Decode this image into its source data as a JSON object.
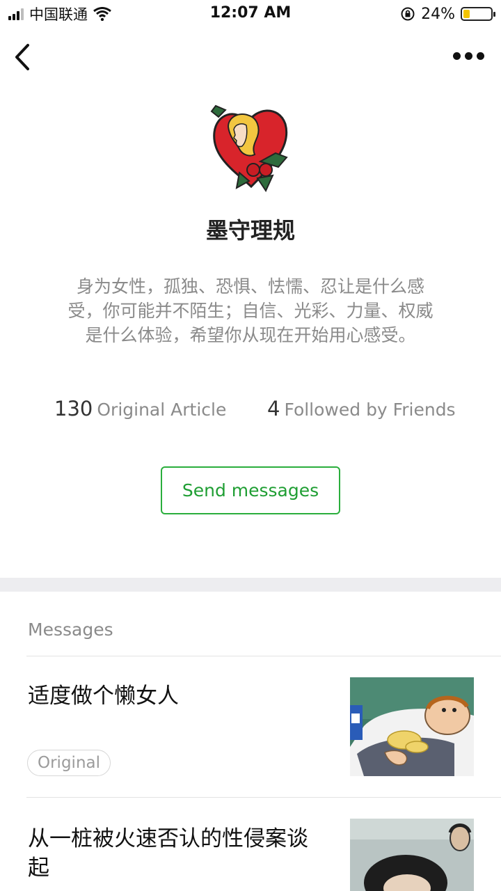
{
  "status_bar": {
    "carrier": "中国联通",
    "time": "12:07 AM",
    "battery_percent": "24%",
    "battery_level": 0.24,
    "battery_color": "#f4c400",
    "signal_bars_filled": 3,
    "icons": [
      "signal-icon",
      "wifi-icon",
      "rotation-lock-icon",
      "battery-icon"
    ]
  },
  "nav": {
    "back_icon": "chevron-left-icon",
    "more_icon": "more-dots-icon"
  },
  "profile": {
    "name": "墨守理规",
    "bio": "身为女性，孤独、恐惧、怯懦、忍让是什么感受，你可能并不陌生；自信、光彩、力量、权威是什么体验，希望你从现在开始用心感受。",
    "stats": {
      "articles_count": "130",
      "articles_label": "Original Article",
      "friends_count": "4",
      "friends_label": "Followed by Friends"
    },
    "send_button_label": "Send messages"
  },
  "colors": {
    "accent_green": "#2aae3c",
    "muted_text": "#8a8a8a",
    "separator_band": "#ededf0"
  },
  "messages": {
    "section_title": "Messages",
    "items": [
      {
        "title": "适度做个懒女人",
        "badge": "Original"
      },
      {
        "title": "从一桩被火速否认的性侵案谈起"
      }
    ]
  }
}
